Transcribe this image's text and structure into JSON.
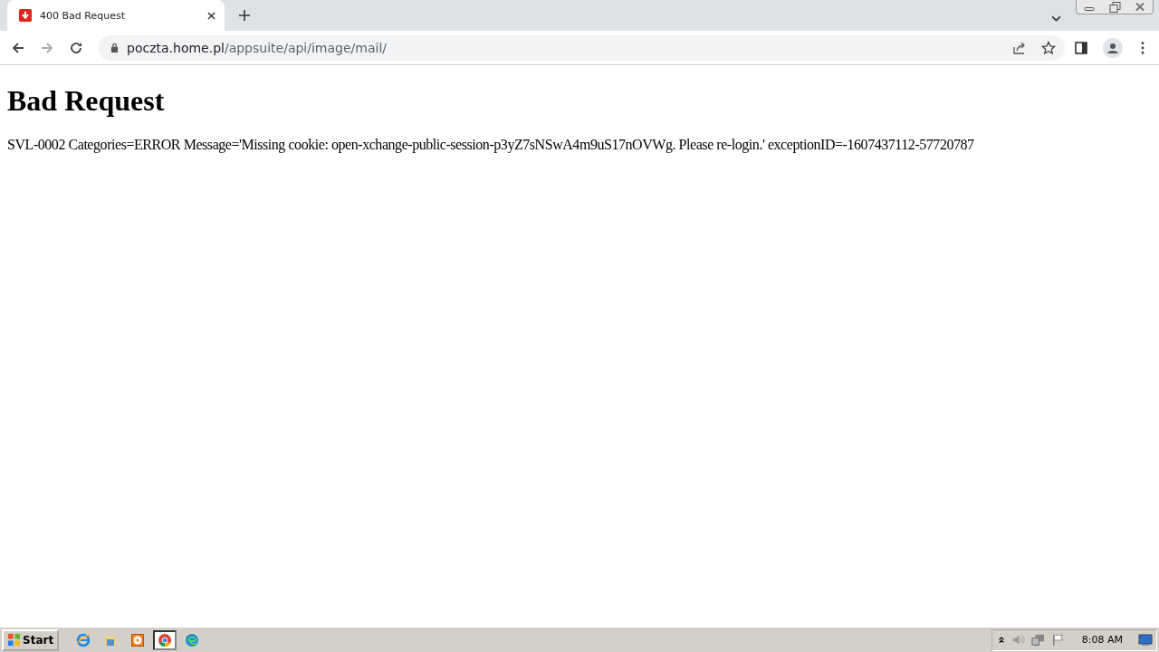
{
  "tabs": [
    {
      "title": "400 Bad Request",
      "selected": true
    }
  ],
  "address_bar": {
    "host": "poczta.home.pl",
    "path": "/appsuite/api/image/mail/"
  },
  "page": {
    "heading": "Bad Request",
    "message": "SVL-0002 Categories=ERROR Message='Missing cookie: open-xchange-public-session-p3yZ7sNSwA4m9uS17nOVWg. Please re-login.' exceptionID=-1607437112-57720787"
  },
  "taskbar": {
    "start_label": "Start",
    "apps": [
      {
        "kind": "ie",
        "selected": false
      },
      {
        "kind": "folder",
        "selected": false
      },
      {
        "kind": "media",
        "selected": false
      },
      {
        "kind": "chrome",
        "selected": true
      },
      {
        "kind": "edge",
        "selected": false
      }
    ],
    "tray": [
      {
        "kind": "chevron"
      },
      {
        "kind": "speaker"
      },
      {
        "kind": "network"
      },
      {
        "kind": "flag"
      }
    ],
    "clock": "8:08 AM"
  }
}
